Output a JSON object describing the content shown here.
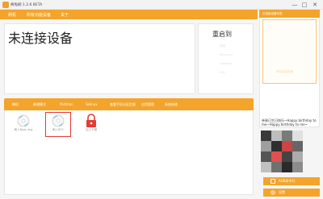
{
  "window": {
    "title": "奇兔刷 1.2.6 BETA",
    "controls": [
      "—",
      "□",
      "✕"
    ]
  },
  "menu": {
    "items": [
      "刷机",
      "所有功能设备",
      "关于"
    ]
  },
  "device": {
    "status": "未连接设备"
  },
  "reboot": {
    "title": "重启到",
    "options": [
      "系统",
      "Recovery",
      "Fastboot",
      "EDL"
    ]
  },
  "tools": {
    "tabs": [
      "刷机",
      "刷递模式",
      "Partition",
      "Selinux",
      "查看手机分区信息",
      "应用管理",
      "系统修改"
    ],
    "items": [
      {
        "label": "刷入Boot.img",
        "icon": "disc-icon"
      },
      {
        "label": "刷入REC",
        "icon": "disc-icon"
      },
      {
        "label": "加上卡槽",
        "icon": "lock-icon"
      }
    ]
  },
  "sidebar": {
    "header": "已连接设备列表",
    "prompt": "等待连接设备",
    "wish": "亲致已生日快乐~Happy birthday to me~Happy birthday to me~",
    "buttons": [
      {
        "label": "ADB命令行",
        "icon": "terminal-icon"
      },
      {
        "label": "设置",
        "icon": "gear-icon"
      }
    ]
  },
  "colors": {
    "accent": "#f4a42a",
    "highlight": "#e53935",
    "lock": "#e53935"
  }
}
